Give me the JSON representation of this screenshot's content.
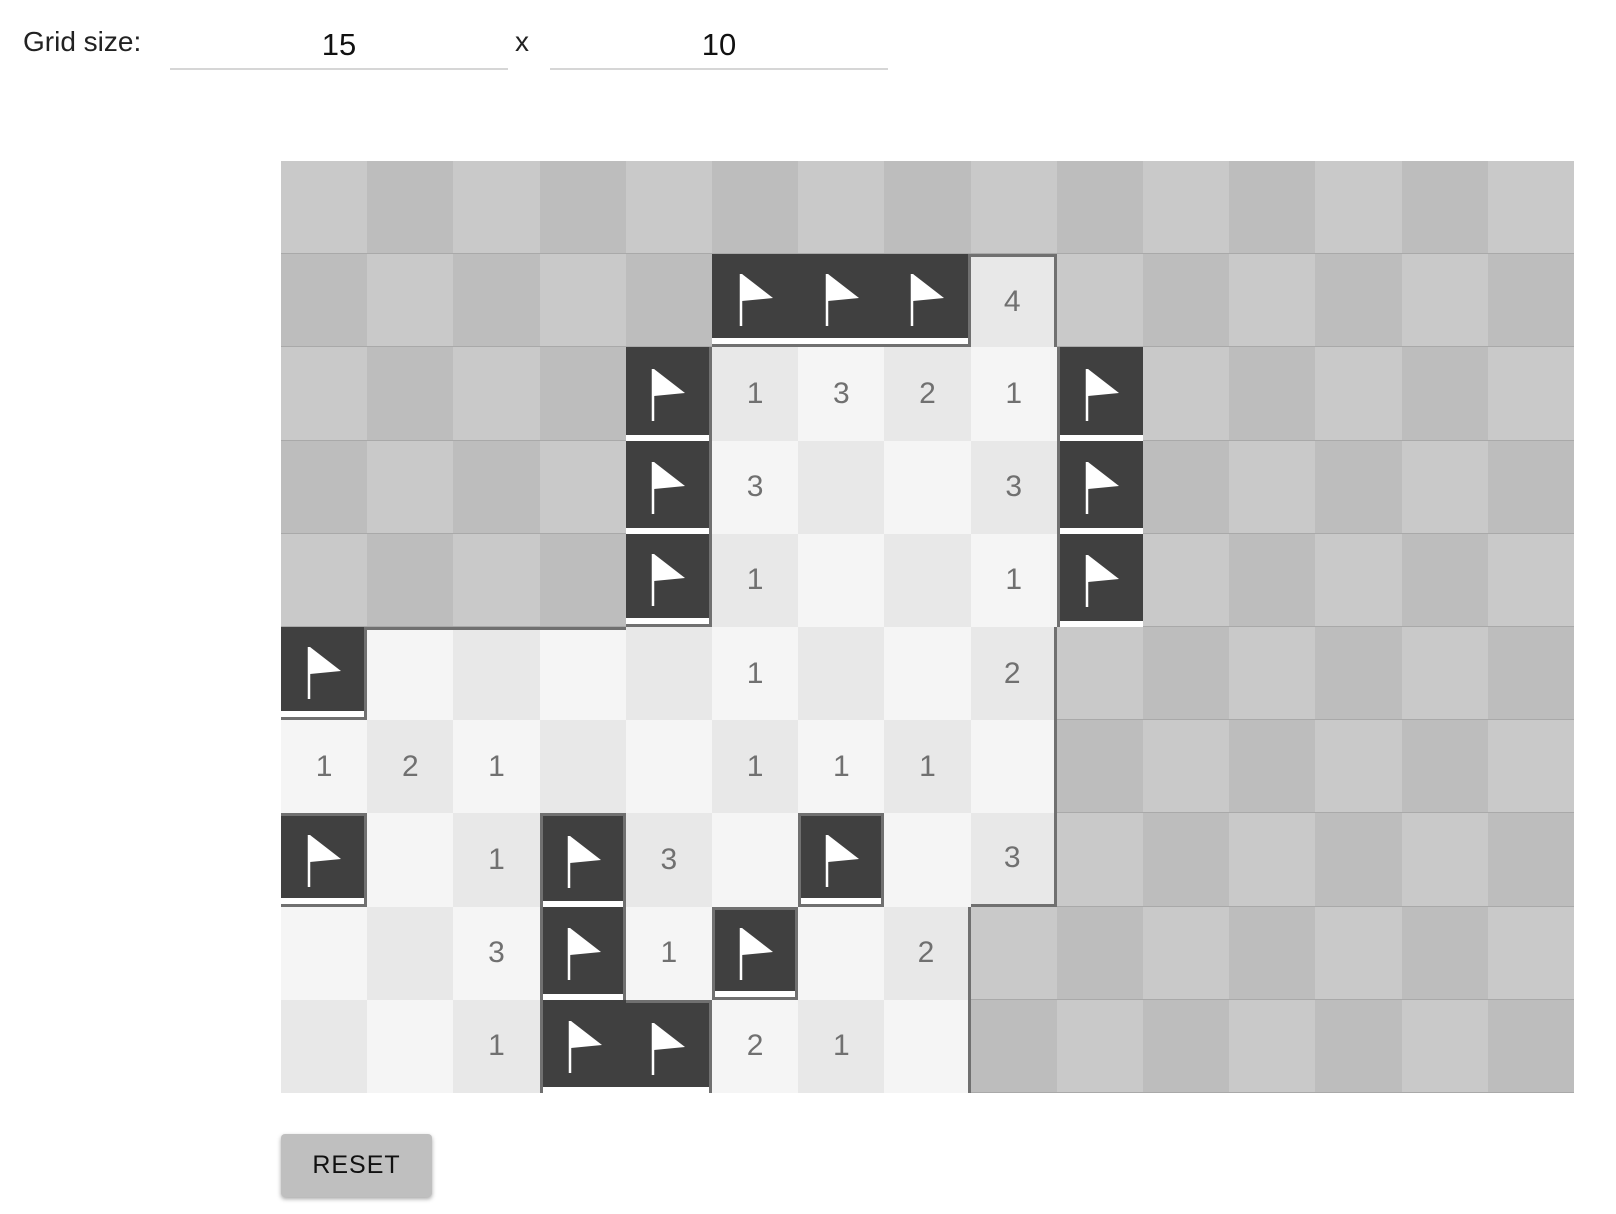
{
  "settings": {
    "label": "Grid size:",
    "width_value": "15",
    "times_sign": "x",
    "height_value": "10"
  },
  "board": {
    "columns": 15,
    "rows_count": 10,
    "legend": {
      "#": "hidden",
      "F": "flagged",
      ".": "revealed-empty",
      "1-8": "revealed-number"
    },
    "rows": [
      "###############",
      "#####FFF4######",
      "####F1321F#####",
      "####F3..3F#####",
      "####F1..1F#####",
      "F....1..2######",
      "121..111.######",
      "F.1F3.F.3######",
      "..3F1F.2#######",
      "..1FF21.#######"
    ]
  },
  "colors": {
    "hidden_light": "#c9c9c9",
    "hidden_dark": "#bdbdbd",
    "open_light": "#f5f5f5",
    "open_dark": "#e8e8e8",
    "flag_tile": "#404040",
    "number_text": "#707070",
    "region_outline": "#707070"
  },
  "icons": {
    "flagged_cell": "flag-icon"
  },
  "actions": {
    "reset_label": "RESET"
  }
}
